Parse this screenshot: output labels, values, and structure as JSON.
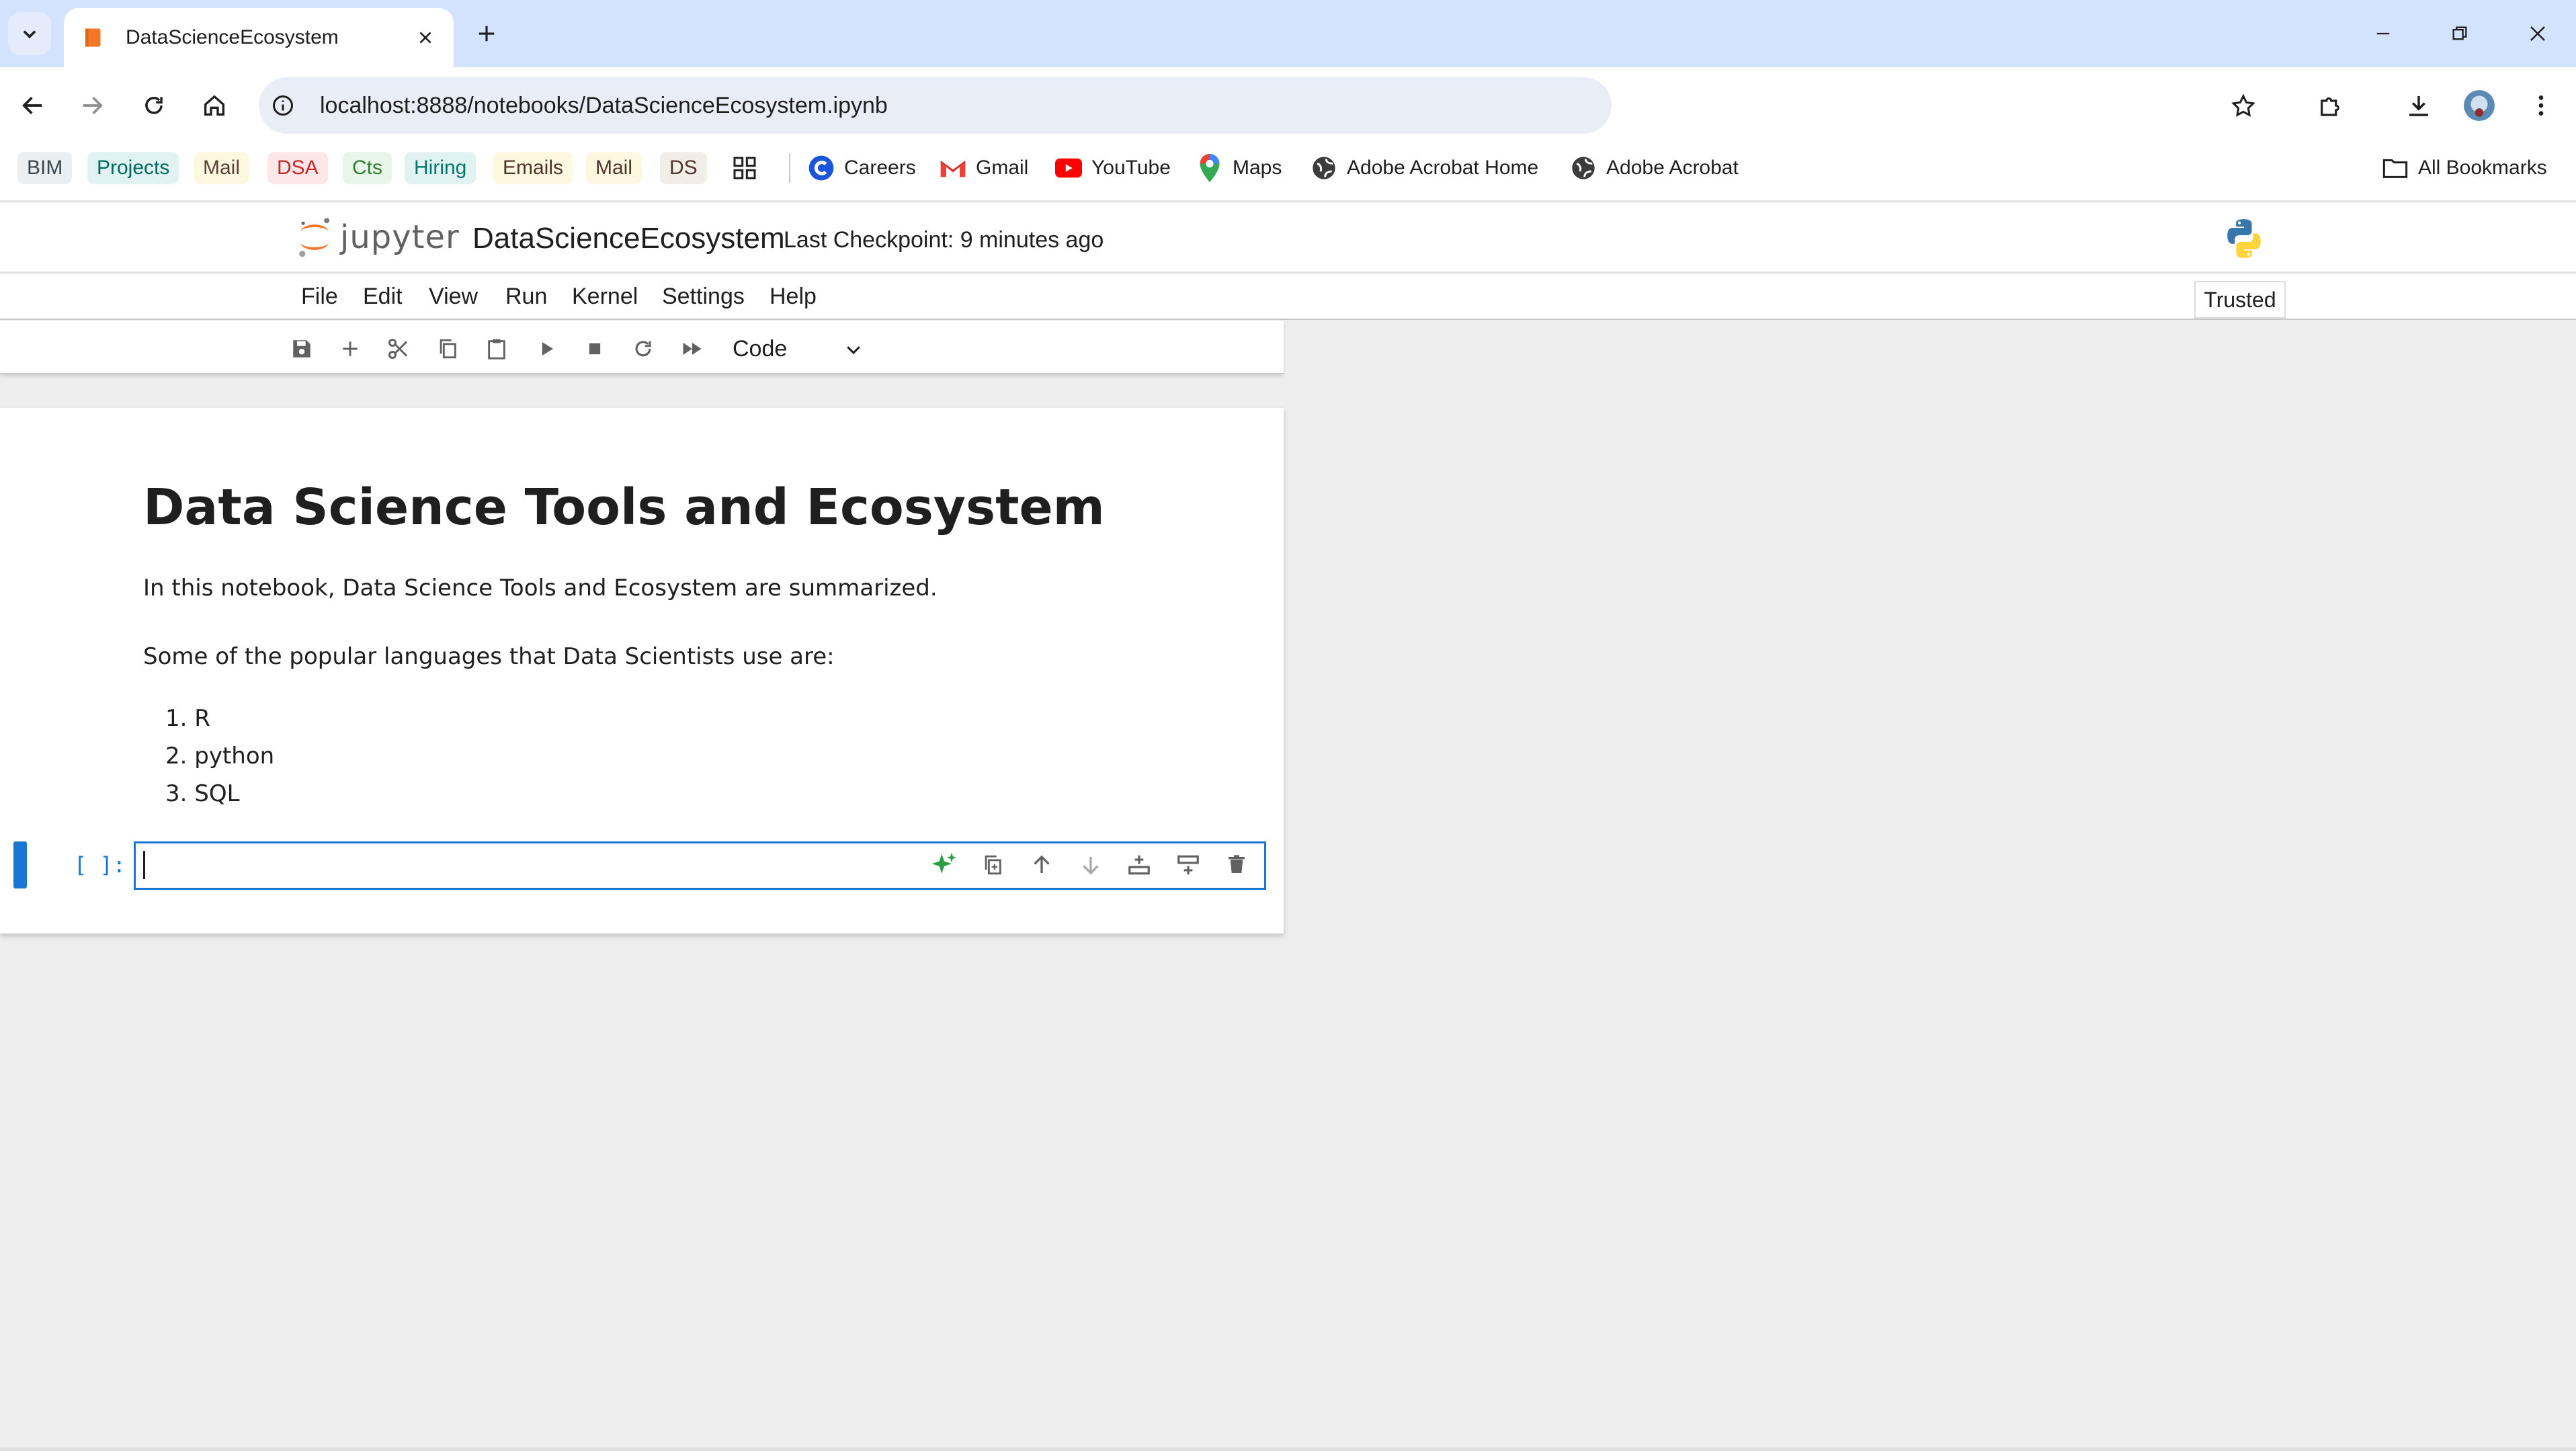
{
  "browser": {
    "tab_title": "DataScienceEcosystem",
    "url": "localhost:8888/notebooks/DataScienceEcosystem.ipynb",
    "bookmarks_chips": [
      {
        "label": "BIM",
        "bg": "#eceff1",
        "fg": "#37474f"
      },
      {
        "label": "Projects",
        "bg": "#e0f2f1",
        "fg": "#00695c"
      },
      {
        "label": "Mail",
        "bg": "#fff8e1",
        "fg": "#5d4037"
      },
      {
        "label": "DSA",
        "bg": "#fde7e9",
        "fg": "#c62828"
      },
      {
        "label": "Cts",
        "bg": "#e8f5e9",
        "fg": "#2e7d32"
      },
      {
        "label": "Hiring",
        "bg": "#e0f2f1",
        "fg": "#00796b"
      },
      {
        "label": "Emails",
        "bg": "#fff8e1",
        "fg": "#4e342e"
      },
      {
        "label": "Mail",
        "bg": "#fff8e1",
        "fg": "#4e342e"
      },
      {
        "label": "DS",
        "bg": "#f3ede7",
        "fg": "#4e342e"
      }
    ],
    "bookmark_links": [
      "Careers",
      "Gmail",
      "YouTube",
      "Maps",
      "Adobe Acrobat Home",
      "Adobe Acrobat"
    ],
    "all_bookmarks": "All Bookmarks"
  },
  "jupyter": {
    "logo_text": "jupyter",
    "notebook_name": "DataScienceEcosystem",
    "checkpoint": "Last Checkpoint: 9 minutes ago",
    "menu": [
      "File",
      "Edit",
      "View",
      "Run",
      "Kernel",
      "Settings",
      "Help"
    ],
    "trusted": "Trusted",
    "cell_type": "Code",
    "accent": "#1976d2"
  },
  "notebook": {
    "heading": "Data Science Tools and Ecosystem",
    "intro": "In this notebook, Data Science Tools and Ecosystem are summarized.",
    "languages_intro": "Some of the popular languages that Data Scientists use are:",
    "languages": [
      "1. R",
      "2. python",
      "3. SQL"
    ],
    "active_cell_prompt": "[ ]:"
  }
}
